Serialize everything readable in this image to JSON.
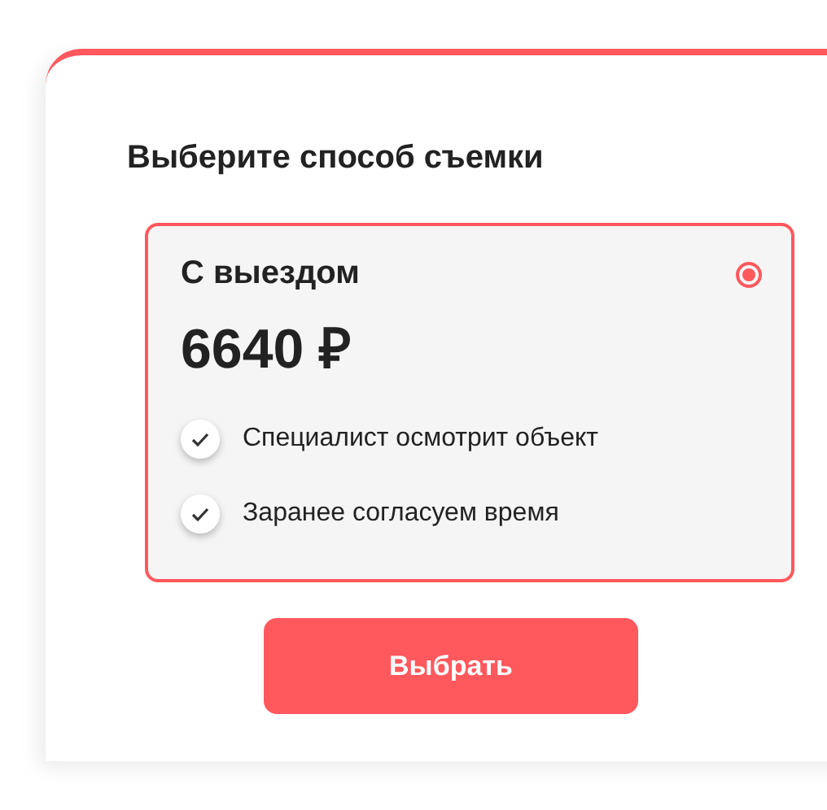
{
  "title": "Выберите способ съемки",
  "options": [
    {
      "name": "С выездом",
      "price": "6640 ₽",
      "selected": true,
      "features": [
        "Специалист осмотрит объект",
        "Заранее согласуем время"
      ]
    }
  ],
  "button": "Выбрать"
}
